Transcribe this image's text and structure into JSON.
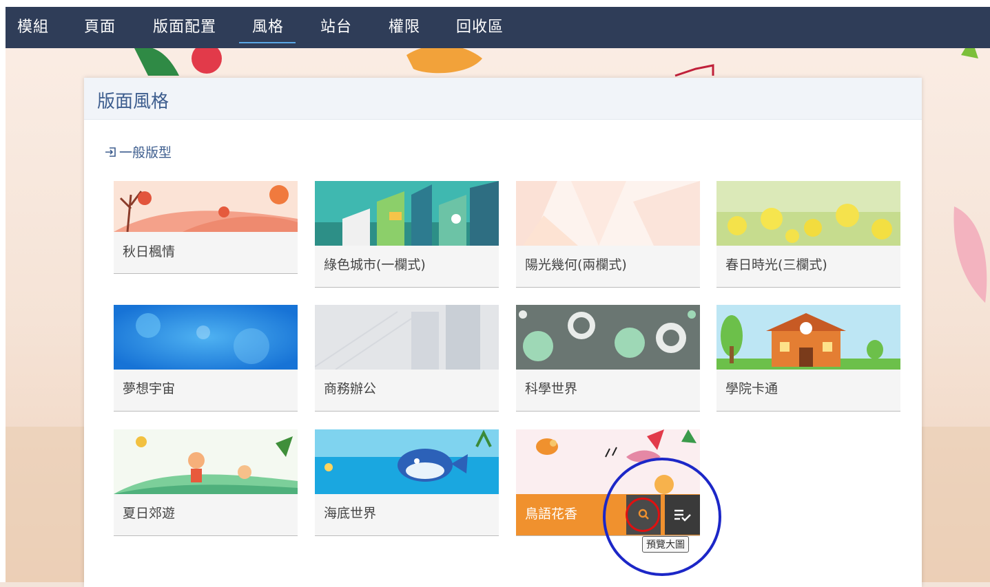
{
  "nav": {
    "items": [
      {
        "label": "模組"
      },
      {
        "label": "頁面"
      },
      {
        "label": "版面配置"
      },
      {
        "label": "風格"
      },
      {
        "label": "站台"
      },
      {
        "label": "權限"
      },
      {
        "label": "回收區"
      }
    ],
    "active": "風格"
  },
  "panel": {
    "title": "版面風格",
    "section_label": "一般版型",
    "section_icon": "sign-in-icon"
  },
  "themes": [
    {
      "name": "秋日楓情"
    },
    {
      "name": "綠色城市(一欄式)"
    },
    {
      "name": "陽光幾何(兩欄式)"
    },
    {
      "name": "春日時光(三欄式)"
    },
    {
      "name": "夢想宇宙"
    },
    {
      "name": "商務辦公"
    },
    {
      "name": "科學世界"
    },
    {
      "name": "學院卡通"
    },
    {
      "name": "夏日郊遊"
    },
    {
      "name": "海底世界"
    },
    {
      "name": "鳥語花香",
      "selected": true
    }
  ],
  "actions": {
    "preview_icon": "search-icon",
    "apply_icon": "list-check-icon",
    "preview_tooltip": "預覽大圖"
  },
  "colors": {
    "navbar": "#2f3d58",
    "active_underline": "#5aa7e6",
    "title_blue": "#3d5d8e",
    "selected_orange": "#f0912e",
    "annotation_blue": "#1c27c7",
    "annotation_red": "#e01010"
  }
}
